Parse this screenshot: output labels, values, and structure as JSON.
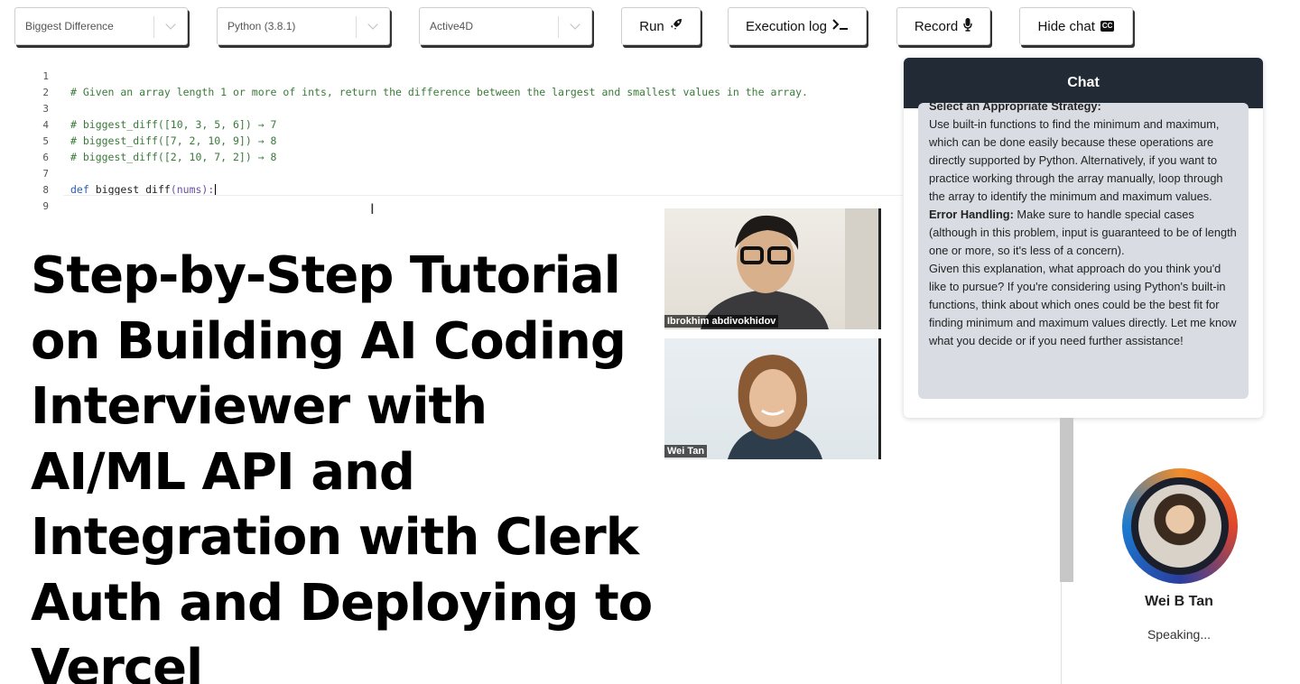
{
  "toolbar": {
    "problem_select": "Biggest Difference",
    "language_select": "Python (3.8.1)",
    "theme_select": "Active4D",
    "run_label": "Run",
    "execution_log_label": "Execution log",
    "record_label": "Record",
    "hide_chat_label": "Hide chat",
    "hide_chat_badge": "CC"
  },
  "editor": {
    "lines": [
      {
        "n": "1",
        "text": ""
      },
      {
        "n": "2",
        "text": "# Given an array length 1 or more of ints, return the difference between the largest and smallest values in the array."
      },
      {
        "n": "3",
        "text": ""
      },
      {
        "n": "4",
        "text": "# biggest_diff([10, 3, 5, 6]) → 7"
      },
      {
        "n": "5",
        "text": "# biggest_diff([7, 2, 10, 9]) → 8"
      },
      {
        "n": "6",
        "text": "# biggest_diff([2, 10, 7, 2]) → 8"
      },
      {
        "n": "7",
        "text": ""
      },
      {
        "n": "8",
        "keyword": "def",
        "name": "biggest_diff",
        "params": "(nums):"
      },
      {
        "n": "9",
        "text": ""
      }
    ]
  },
  "headline": "Step-by-Step Tutorial on Building AI Coding Interviewer with AI/ML API and Integration with Clerk Auth and Deploying to Vercel",
  "participants": [
    {
      "name": "Ibrokhim abdivokhidov"
    },
    {
      "name": "Wei Tan"
    }
  ],
  "chat": {
    "title": "Chat",
    "cut_heading": "Select an Appropriate Strategy:",
    "para1": "Use built-in functions to find the minimum and maximum, which can be done easily because these operations are directly supported by Python. Alternatively, if you want to practice working through the array manually, loop through the array to identify the minimum and maximum values.",
    "error_label": "Error Handling:",
    "error_text": " Make sure to handle special cases (although in this problem, input is guaranteed to be of length one or more, so it's less of a concern).",
    "para3": "Given this explanation, what approach do you think you'd like to pursue? If you're considering using Python's built-in functions, think about which ones could be the best fit for finding minimum and maximum values directly. Let me know what you decide or if you need further assistance!"
  },
  "speaker": {
    "name": "Wei B Tan",
    "status": "Speaking..."
  },
  "icons": {
    "run": "rocket-icon",
    "log": "terminal-icon",
    "record": "microphone-icon",
    "chevron": "chevron-down-icon"
  },
  "colors": {
    "chat_header": "#222a35",
    "chat_bubble": "#d9dde3",
    "comment": "#3a7a3a",
    "keyword": "#2a5fb0"
  }
}
